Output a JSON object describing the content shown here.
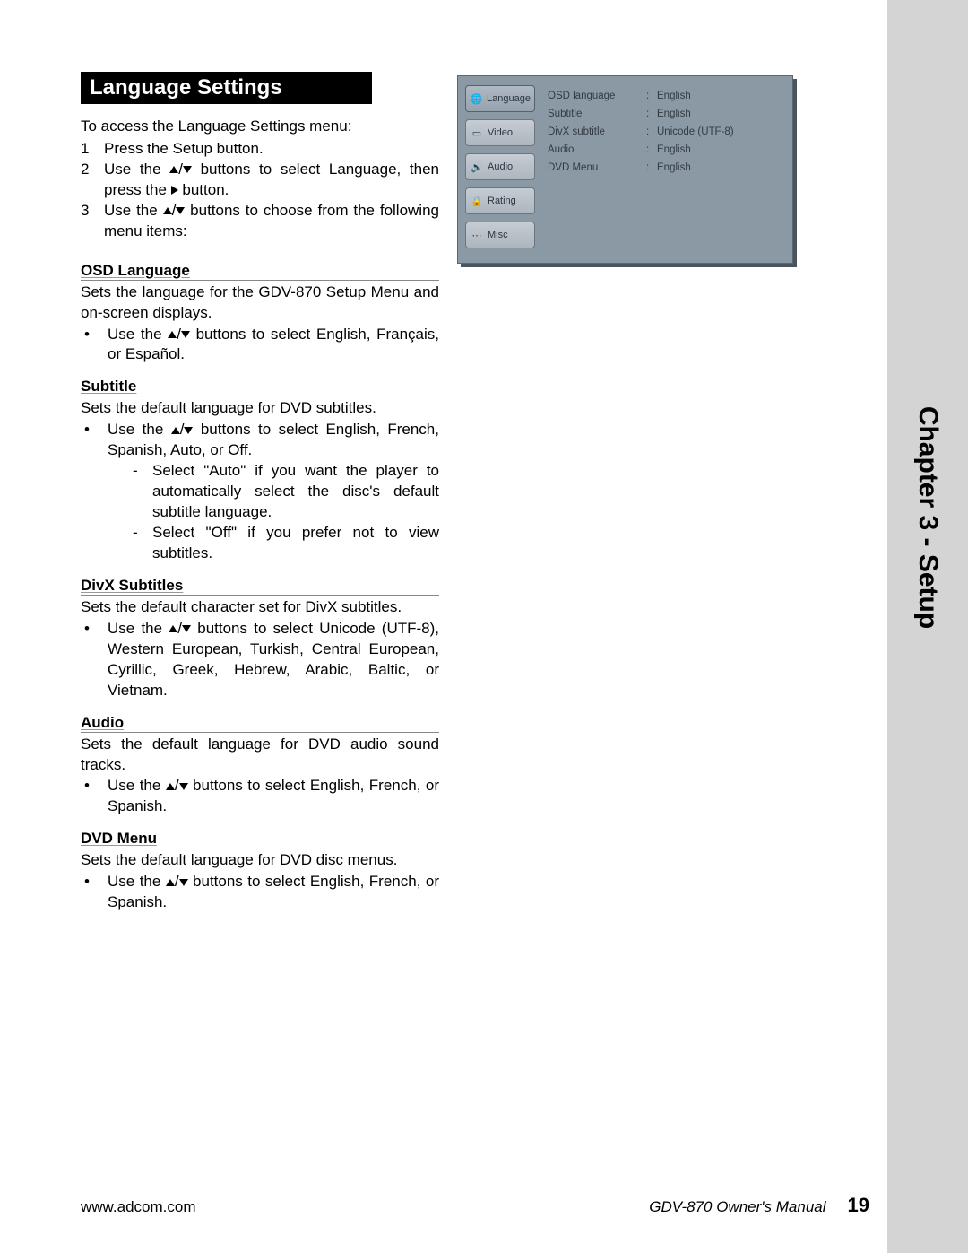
{
  "sidebar": {
    "label": "Chapter 3 - Setup"
  },
  "section_title": "Language Settings",
  "intro": "To access the Language Settings menu:",
  "steps": [
    {
      "num": "1",
      "text": "Press the Setup button."
    },
    {
      "num": "2",
      "text_pre": "Use the ",
      "text_mid": " buttons to select Language, then press the ",
      "text_post": " button."
    },
    {
      "num": "3",
      "text_pre": "Use the ",
      "text_post": " buttons to choose from the following menu items:"
    }
  ],
  "subsections": {
    "osd_language": {
      "title": "OSD Language",
      "desc": "Sets the language for the GDV-870 Setup Menu and on-screen displays.",
      "bullet_pre": "Use the ",
      "bullet_post": " buttons to select English, Français, or Español."
    },
    "subtitle": {
      "title": "Subtitle",
      "desc": "Sets the default language for DVD subtitles.",
      "bullet_pre": "Use the ",
      "bullet_post": " buttons to select English, French, Spanish, Auto, or Off.",
      "dash1": "Select \"Auto\" if you want the player to automatically select the disc's default subtitle language.",
      "dash2": "Select \"Off\" if you prefer not to view subtitles."
    },
    "divx": {
      "title": "DivX Subtitles",
      "desc": "Sets the default character set for DivX subtitles.",
      "bullet_pre": "Use the ",
      "bullet_post": " buttons to select Unicode (UTF-8), Western European, Turkish, Central European, Cyrillic, Greek, Hebrew, Arabic, Baltic, or Vietnam."
    },
    "audio": {
      "title": "Audio",
      "desc": "Sets the default language for DVD audio sound tracks.",
      "bullet_pre": "Use the ",
      "bullet_post": " buttons to select English, French, or Spanish."
    },
    "dvdmenu": {
      "title": "DVD Menu",
      "desc": "Sets the default language for DVD disc menus.",
      "bullet_pre": "Use the ",
      "bullet_post": " buttons to select English, French, or Spanish."
    }
  },
  "osd": {
    "tabs": [
      {
        "label": "Language"
      },
      {
        "label": "Video"
      },
      {
        "label": "Audio"
      },
      {
        "label": "Rating"
      },
      {
        "label": "Misc"
      }
    ],
    "rows": [
      {
        "key": "OSD language",
        "value": "English"
      },
      {
        "key": "Subtitle",
        "value": "English"
      },
      {
        "key": "DivX subtitle",
        "value": "Unicode (UTF-8)"
      },
      {
        "key": "Audio",
        "value": "English"
      },
      {
        "key": "DVD Menu",
        "value": "English"
      }
    ]
  },
  "footer": {
    "url": "www.adcom.com",
    "manual": "GDV-870 Owner's Manual",
    "page": "19"
  }
}
